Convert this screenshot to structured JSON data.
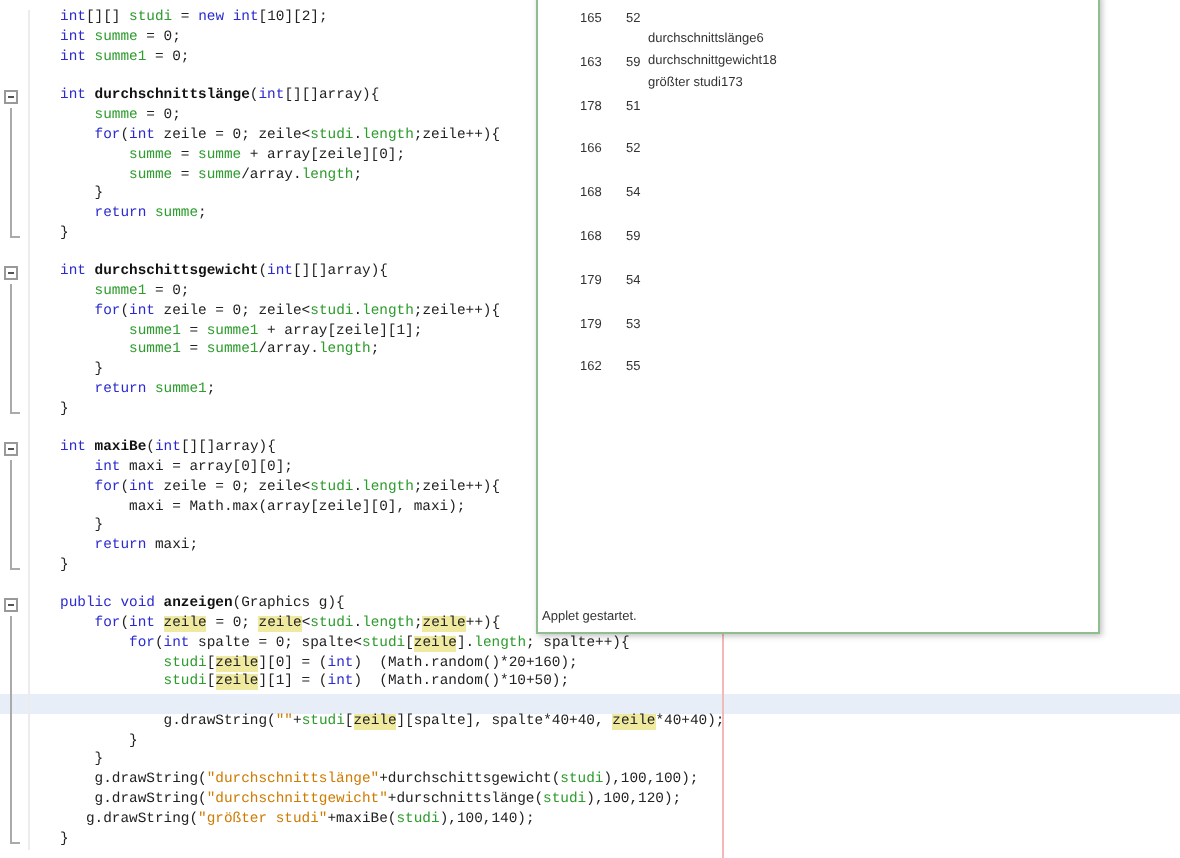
{
  "editor": {
    "lines": [
      {
        "kind": "code",
        "current": false,
        "segments": [
          {
            "kind": "keyword",
            "text": "int"
          },
          {
            "kind": "plain",
            "text": "[][] "
          },
          {
            "kind": "field",
            "text": "studi"
          },
          {
            "kind": "plain",
            "text": " = "
          },
          {
            "kind": "keyword",
            "text": "new int"
          },
          {
            "kind": "plain",
            "text": "[10][2];"
          }
        ]
      },
      {
        "kind": "code",
        "current": false,
        "segments": [
          {
            "kind": "keyword",
            "text": "int "
          },
          {
            "kind": "field",
            "text": "summe"
          },
          {
            "kind": "plain",
            "text": " = 0;"
          }
        ]
      },
      {
        "kind": "code",
        "current": false,
        "segments": [
          {
            "kind": "keyword",
            "text": "int "
          },
          {
            "kind": "field",
            "text": "summe1"
          },
          {
            "kind": "plain",
            "text": " = 0;"
          }
        ]
      },
      {
        "kind": "code",
        "current": false
      },
      {
        "kind": "fold_start",
        "current": false,
        "segments": [
          {
            "kind": "keyword",
            "text": "int "
          },
          {
            "kind": "name",
            "text": "durchschnittslänge"
          },
          {
            "kind": "plain",
            "text": "("
          },
          {
            "kind": "keyword",
            "text": "int"
          },
          {
            "kind": "plain",
            "text": "[][]array){"
          }
        ]
      },
      {
        "kind": "code",
        "current": false,
        "segments": [
          {
            "kind": "field",
            "text": "    summe"
          },
          {
            "kind": "plain",
            "text": " = 0;"
          }
        ]
      },
      {
        "kind": "code",
        "current": false,
        "segments": [
          {
            "kind": "keyword",
            "text": "    for"
          },
          {
            "kind": "plain",
            "text": "("
          },
          {
            "kind": "keyword",
            "text": "int"
          },
          {
            "kind": "plain",
            "text": " zeile = 0; zeile<"
          },
          {
            "kind": "field",
            "text": "studi"
          },
          {
            "kind": "plain",
            "text": "."
          },
          {
            "kind": "field",
            "text": "length"
          },
          {
            "kind": "plain",
            "text": ";zeile++){"
          }
        ]
      },
      {
        "kind": "code",
        "current": false,
        "segments": [
          {
            "kind": "field",
            "text": "        summe"
          },
          {
            "kind": "plain",
            "text": " = "
          },
          {
            "kind": "field",
            "text": "summe"
          },
          {
            "kind": "plain",
            "text": " + array[zeile][0];"
          }
        ]
      },
      {
        "kind": "code",
        "current": false,
        "segments": [
          {
            "kind": "field",
            "text": "        summe"
          },
          {
            "kind": "plain",
            "text": " = "
          },
          {
            "kind": "field",
            "text": "summe"
          },
          {
            "kind": "plain",
            "text": "/array."
          },
          {
            "kind": "field",
            "text": "length"
          },
          {
            "kind": "plain",
            "text": ";"
          }
        ]
      },
      {
        "kind": "code",
        "current": false,
        "segments": [
          {
            "kind": "plain",
            "text": "    }"
          }
        ]
      },
      {
        "kind": "code",
        "current": false,
        "segments": [
          {
            "kind": "keyword",
            "text": "    return "
          },
          {
            "kind": "field",
            "text": "summe"
          },
          {
            "kind": "plain",
            "text": ";"
          }
        ]
      },
      {
        "kind": "fold_end",
        "current": false,
        "segments": [
          {
            "kind": "plain",
            "text": "}"
          }
        ]
      },
      {
        "kind": "code",
        "current": false
      },
      {
        "kind": "fold_start",
        "current": false,
        "segments": [
          {
            "kind": "keyword",
            "text": "int "
          },
          {
            "kind": "name",
            "text": "durchschittsgewicht"
          },
          {
            "kind": "plain",
            "text": "("
          },
          {
            "kind": "keyword",
            "text": "int"
          },
          {
            "kind": "plain",
            "text": "[][]array){"
          }
        ]
      },
      {
        "kind": "code",
        "current": false,
        "segments": [
          {
            "kind": "field",
            "text": "    summe1"
          },
          {
            "kind": "plain",
            "text": " = 0;"
          }
        ]
      },
      {
        "kind": "code",
        "current": false,
        "segments": [
          {
            "kind": "keyword",
            "text": "    for"
          },
          {
            "kind": "plain",
            "text": "("
          },
          {
            "kind": "keyword",
            "text": "int"
          },
          {
            "kind": "plain",
            "text": " zeile = 0; zeile<"
          },
          {
            "kind": "field",
            "text": "studi"
          },
          {
            "kind": "plain",
            "text": "."
          },
          {
            "kind": "field",
            "text": "length"
          },
          {
            "kind": "plain",
            "text": ";zeile++){"
          }
        ]
      },
      {
        "kind": "code",
        "current": false,
        "segments": [
          {
            "kind": "field",
            "text": "        summe1"
          },
          {
            "kind": "plain",
            "text": " = "
          },
          {
            "kind": "field",
            "text": "summe1"
          },
          {
            "kind": "plain",
            "text": " + array[zeile][1];"
          }
        ]
      },
      {
        "kind": "code",
        "current": false,
        "segments": [
          {
            "kind": "field",
            "text": "        summe1"
          },
          {
            "kind": "plain",
            "text": " = "
          },
          {
            "kind": "field",
            "text": "summe1"
          },
          {
            "kind": "plain",
            "text": "/array."
          },
          {
            "kind": "field",
            "text": "length"
          },
          {
            "kind": "plain",
            "text": ";"
          }
        ]
      },
      {
        "kind": "code",
        "current": false,
        "segments": [
          {
            "kind": "plain",
            "text": "    }"
          }
        ]
      },
      {
        "kind": "code",
        "current": false,
        "segments": [
          {
            "kind": "keyword",
            "text": "    return "
          },
          {
            "kind": "field",
            "text": "summe1"
          },
          {
            "kind": "plain",
            "text": ";"
          }
        ]
      },
      {
        "kind": "fold_end",
        "current": false,
        "segments": [
          {
            "kind": "plain",
            "text": "}"
          }
        ]
      },
      {
        "kind": "code",
        "current": false
      },
      {
        "kind": "fold_start",
        "current": false,
        "segments": [
          {
            "kind": "keyword",
            "text": "int "
          },
          {
            "kind": "name",
            "text": "maxiBe"
          },
          {
            "kind": "plain",
            "text": "("
          },
          {
            "kind": "keyword",
            "text": "int"
          },
          {
            "kind": "plain",
            "text": "[][]array){"
          }
        ]
      },
      {
        "kind": "code",
        "current": false,
        "segments": [
          {
            "kind": "keyword",
            "text": "    int"
          },
          {
            "kind": "plain",
            "text": " maxi = array[0][0];"
          }
        ]
      },
      {
        "kind": "code",
        "current": false,
        "segments": [
          {
            "kind": "keyword",
            "text": "    for"
          },
          {
            "kind": "plain",
            "text": "("
          },
          {
            "kind": "keyword",
            "text": "int"
          },
          {
            "kind": "plain",
            "text": " zeile = 0; zeile<"
          },
          {
            "kind": "field",
            "text": "studi"
          },
          {
            "kind": "plain",
            "text": "."
          },
          {
            "kind": "field",
            "text": "length"
          },
          {
            "kind": "plain",
            "text": ";zeile++){"
          }
        ]
      },
      {
        "kind": "code",
        "current": false,
        "segments": [
          {
            "kind": "plain",
            "text": "        maxi = Math.max(array[zeile][0], maxi);"
          }
        ]
      },
      {
        "kind": "code",
        "current": false,
        "segments": [
          {
            "kind": "plain",
            "text": "    }"
          }
        ]
      },
      {
        "kind": "code",
        "current": false,
        "segments": [
          {
            "kind": "keyword",
            "text": "    return"
          },
          {
            "kind": "plain",
            "text": " maxi;"
          }
        ]
      },
      {
        "kind": "fold_end",
        "current": false,
        "segments": [
          {
            "kind": "plain",
            "text": "}"
          }
        ]
      },
      {
        "kind": "code",
        "current": false
      },
      {
        "kind": "fold_start",
        "current": false,
        "segments": [
          {
            "kind": "keyword",
            "text": "public void "
          },
          {
            "kind": "name",
            "text": "anzeigen"
          },
          {
            "kind": "plain",
            "text": "(Graphics g){"
          }
        ]
      },
      {
        "kind": "code",
        "current": false,
        "segments": [
          {
            "kind": "keyword",
            "text": "    for"
          },
          {
            "kind": "plain",
            "text": "("
          },
          {
            "kind": "keyword",
            "text": "int "
          },
          {
            "kind": "match",
            "text": "zeile"
          },
          {
            "kind": "plain",
            "text": " = 0; "
          },
          {
            "kind": "match",
            "text": "zeile"
          },
          {
            "kind": "plain",
            "text": "<"
          },
          {
            "kind": "field",
            "text": "studi"
          },
          {
            "kind": "plain",
            "text": "."
          },
          {
            "kind": "field",
            "text": "length"
          },
          {
            "kind": "plain",
            "text": ";"
          },
          {
            "kind": "match",
            "text": "zeile"
          },
          {
            "kind": "plain",
            "text": "++){"
          }
        ]
      },
      {
        "kind": "code",
        "current": false,
        "segments": [
          {
            "kind": "keyword",
            "text": "        for"
          },
          {
            "kind": "plain",
            "text": "("
          },
          {
            "kind": "keyword",
            "text": "int"
          },
          {
            "kind": "plain",
            "text": " spalte = 0; spalte<"
          },
          {
            "kind": "field",
            "text": "studi"
          },
          {
            "kind": "plain",
            "text": "["
          },
          {
            "kind": "match",
            "text": "zeile"
          },
          {
            "kind": "plain",
            "text": "]."
          },
          {
            "kind": "field",
            "text": "length"
          },
          {
            "kind": "plain",
            "text": "; spalte++){"
          }
        ]
      },
      {
        "kind": "code",
        "current": false,
        "segments": [
          {
            "kind": "field",
            "text": "            studi"
          },
          {
            "kind": "plain",
            "text": "["
          },
          {
            "kind": "match",
            "text": "zeile"
          },
          {
            "kind": "plain",
            "text": "][0] = ("
          },
          {
            "kind": "keyword",
            "text": "int"
          },
          {
            "kind": "plain",
            "text": ")  (Math.random()*20+160);"
          }
        ]
      },
      {
        "kind": "code",
        "current": false,
        "segments": [
          {
            "kind": "field",
            "text": "            studi"
          },
          {
            "kind": "plain",
            "text": "["
          },
          {
            "kind": "match",
            "text": "zeile"
          },
          {
            "kind": "plain",
            "text": "][1] = ("
          },
          {
            "kind": "keyword",
            "text": "int"
          },
          {
            "kind": "plain",
            "text": ")  (Math.random()*10+50);"
          }
        ]
      },
      {
        "kind": "code",
        "current": true
      },
      {
        "kind": "code",
        "current": false,
        "segments": [
          {
            "kind": "plain",
            "text": "            g.drawString("
          },
          {
            "kind": "string",
            "text": "\"\""
          },
          {
            "kind": "plain",
            "text": "+"
          },
          {
            "kind": "field",
            "text": "studi"
          },
          {
            "kind": "plain",
            "text": "["
          },
          {
            "kind": "match",
            "text": "zeile"
          },
          {
            "kind": "plain",
            "text": "][spalte], spalte*40+40, "
          },
          {
            "kind": "match",
            "text": "zeile"
          },
          {
            "kind": "plain",
            "text": "*40+40);"
          }
        ]
      },
      {
        "kind": "code",
        "current": false,
        "segments": [
          {
            "kind": "plain",
            "text": "        }"
          }
        ]
      },
      {
        "kind": "code",
        "current": false,
        "segments": [
          {
            "kind": "plain",
            "text": "    }"
          }
        ]
      },
      {
        "kind": "code",
        "current": false,
        "segments": [
          {
            "kind": "plain",
            "text": "    g.drawString("
          },
          {
            "kind": "string",
            "text": "\"durchschnittslänge\""
          },
          {
            "kind": "plain",
            "text": "+durchschittsgewicht("
          },
          {
            "kind": "field",
            "text": "studi"
          },
          {
            "kind": "plain",
            "text": "),100,100);"
          }
        ]
      },
      {
        "kind": "code",
        "current": false,
        "segments": [
          {
            "kind": "plain",
            "text": "    g.drawString("
          },
          {
            "kind": "string",
            "text": "\"durchschnittgewicht\""
          },
          {
            "kind": "plain",
            "text": "+durschnittslänge("
          },
          {
            "kind": "field",
            "text": "studi"
          },
          {
            "kind": "plain",
            "text": "),100,120);"
          }
        ]
      },
      {
        "kind": "code",
        "current": false,
        "segments": [
          {
            "kind": "plain",
            "text": "   g.drawString("
          },
          {
            "kind": "string",
            "text": "\"größter studi\""
          },
          {
            "kind": "plain",
            "text": "+maxiBe("
          },
          {
            "kind": "field",
            "text": "studi"
          },
          {
            "kind": "plain",
            "text": "),100,140);"
          }
        ]
      },
      {
        "kind": "fold_end",
        "current": false,
        "segments": [
          {
            "kind": "plain",
            "text": "}"
          }
        ]
      }
    ]
  },
  "applet": {
    "rows": [
      {
        "column_1": "165",
        "column_2": "52"
      },
      {
        "column_1": "163",
        "column_2": "59"
      },
      {
        "column_1": "178",
        "column_2": "51"
      },
      {
        "column_1": "166",
        "column_2": "52"
      },
      {
        "column_1": "168",
        "column_2": "54"
      },
      {
        "column_1": "168",
        "column_2": "59"
      },
      {
        "column_1": "179",
        "column_2": "54"
      },
      {
        "column_1": "179",
        "column_2": "53"
      },
      {
        "column_1": "162",
        "column_2": "55"
      }
    ],
    "texts": [
      "durchschnittslänge6",
      "durchschnittgewicht18",
      "größter studi173"
    ],
    "status": "Applet gestartet."
  }
}
